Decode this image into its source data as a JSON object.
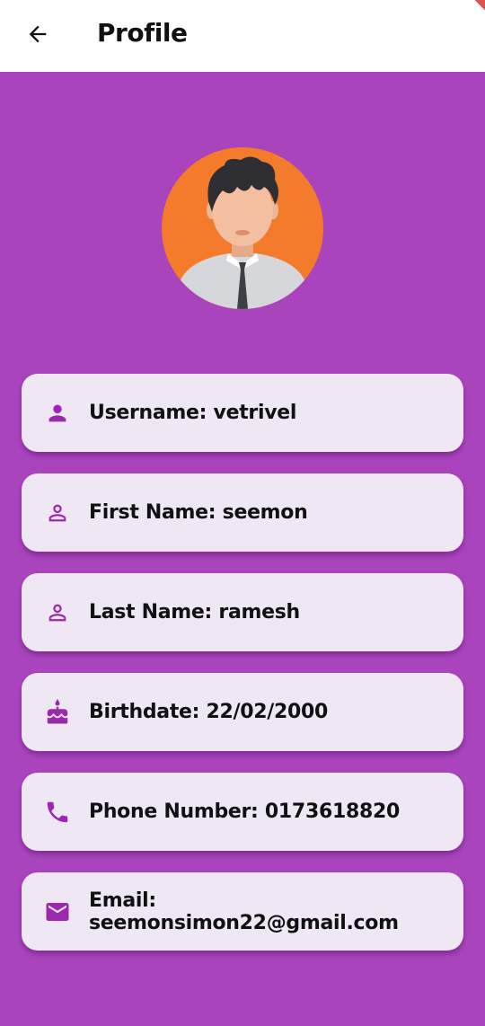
{
  "appbar": {
    "title": "Profile"
  },
  "colors": {
    "accent": "#9c27b0",
    "background": "#a944bd",
    "card": "#efe8f4"
  },
  "profile_items": [
    {
      "icon": "person-filled-icon",
      "label": "Username: vetrivel"
    },
    {
      "icon": "person-outline-icon",
      "label": "First Name: seemon"
    },
    {
      "icon": "person-outline-icon",
      "label": "Last Name: ramesh"
    },
    {
      "icon": "cake-icon",
      "label": "Birthdate: 22/02/2000"
    },
    {
      "icon": "phone-icon",
      "label": "Phone Number: 0173618820"
    },
    {
      "icon": "email-icon",
      "label": "Email: seemonsimon22@gmail.com"
    }
  ]
}
